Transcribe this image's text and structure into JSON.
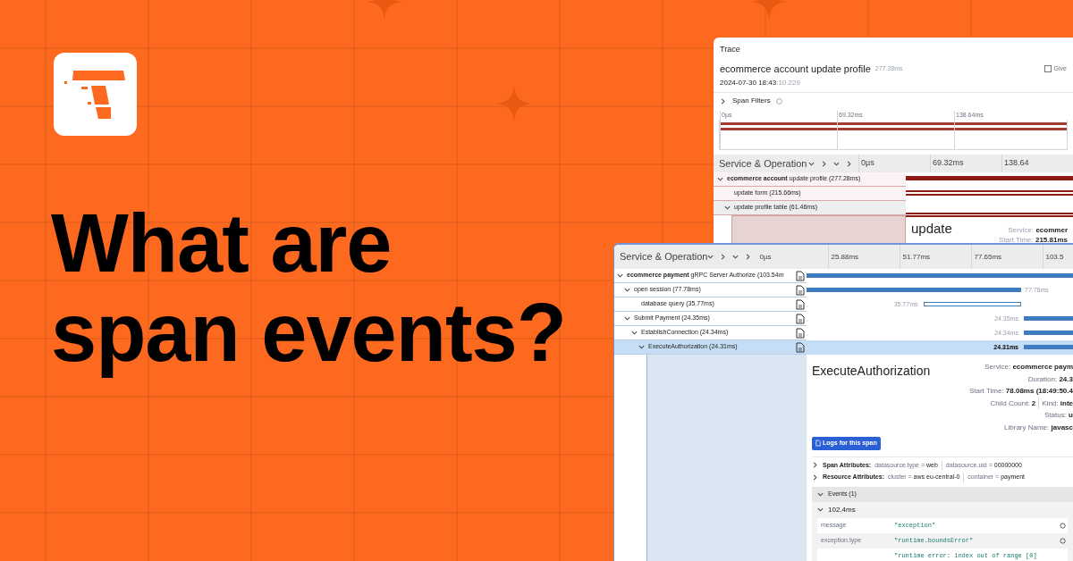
{
  "headline": [
    "What are",
    "span events?"
  ],
  "trace_window": {
    "title": "Trace",
    "trace_name": "ecommerce account update profile",
    "trace_duration": "277.28ms",
    "date": "2024-07-30 18:43",
    "date_ms": ":10.229",
    "feedback": "Give",
    "filters": "Span Filters",
    "minimap_ticks": [
      "0µs",
      "69.32ms",
      "138.64ms"
    ],
    "header": "Service & Operation",
    "ticks": [
      "0µs",
      "69.32ms",
      "138.64"
    ],
    "rows": [
      {
        "service": "ecommerce account",
        "name": "update profile (277.28ms)",
        "expanded": true,
        "selected": false,
        "children": [
          {
            "name": "update form (215.66ms)",
            "selected": false
          },
          {
            "name": "update profile table (61.46ms)",
            "expanded": true,
            "selected": true
          }
        ]
      }
    ],
    "detail_title": "update",
    "fields": [
      {
        "label": "Service:",
        "value": "ecommer"
      },
      {
        "label": "Start Time:",
        "value": "215.81ms"
      }
    ]
  },
  "span_window": {
    "header": "Service & Operation",
    "ticks": [
      "0µs",
      "25.88ms",
      "51.77ms",
      "77.65ms",
      "103.5"
    ],
    "rows": [
      {
        "service": "ecommerce payment",
        "name": "gRPC Server Authorize (103.54m",
        "expanded": true,
        "selected": false,
        "children": [
          {
            "name": "open session (77.78ms)",
            "bar_label": "77.78ms",
            "expanded": true,
            "selected": false,
            "children": [
              {
                "name": "database query (35.77ms)",
                "bar_label": "35.77ms",
                "selected": false
              }
            ]
          },
          {
            "name": "Submit Payment (24.35ms)",
            "bar_label": "24.35ms",
            "expanded": true,
            "selected": false,
            "children": [
              {
                "name": "EstablishConnection (24.34ms)",
                "bar_label": "24.34ms",
                "expanded": true,
                "selected": false,
                "children": [
                  {
                    "name": "ExecuteAuthorization (24.31ms)",
                    "bar_label": "24.31ms",
                    "expanded": true,
                    "selected": true
                  }
                ]
              }
            ]
          }
        ]
      }
    ],
    "detail": {
      "title": "ExecuteAuthorization",
      "fields": [
        [
          {
            "label": "Service:",
            "value": "ecommerce paym"
          }
        ],
        [
          {
            "label": "Duration:",
            "value": "24.3"
          }
        ],
        [
          {
            "label": "Start Time:",
            "value": "78.08ms (18:49:50.4"
          }
        ],
        [
          {
            "label": "Child Count:",
            "value": "2"
          },
          {
            "label": "Kind:",
            "value": "inte"
          }
        ],
        [
          {
            "label": "Status:",
            "value": "u"
          }
        ],
        [
          {
            "label": "Library Name:",
            "value": "javasc"
          }
        ]
      ],
      "logs_button": "Logs for this span",
      "attributes": [
        {
          "label": "Span Attributes:",
          "items": [
            {
              "key": "datasource.type",
              "sep": "=",
              "value": "web"
            },
            {
              "key": "datasource.uid",
              "sep": "=",
              "value": "00000000"
            }
          ]
        },
        {
          "label": "Resource Attributes:",
          "items": [
            {
              "key": "cluster",
              "sep": "=",
              "value": "aws eu-central-0"
            },
            {
              "key": "container",
              "sep": "=",
              "value": "payment"
            }
          ]
        }
      ],
      "events_title": "Events (1)",
      "event": {
        "time": "102.4ms",
        "expanded": true,
        "rows": [
          {
            "key": "message",
            "value": "\"exception\""
          },
          {
            "key": "exception.type",
            "value": "\"runtime.boundsError\""
          },
          {
            "value": "\"runtime error: index out of range [0]"
          }
        ]
      }
    }
  }
}
